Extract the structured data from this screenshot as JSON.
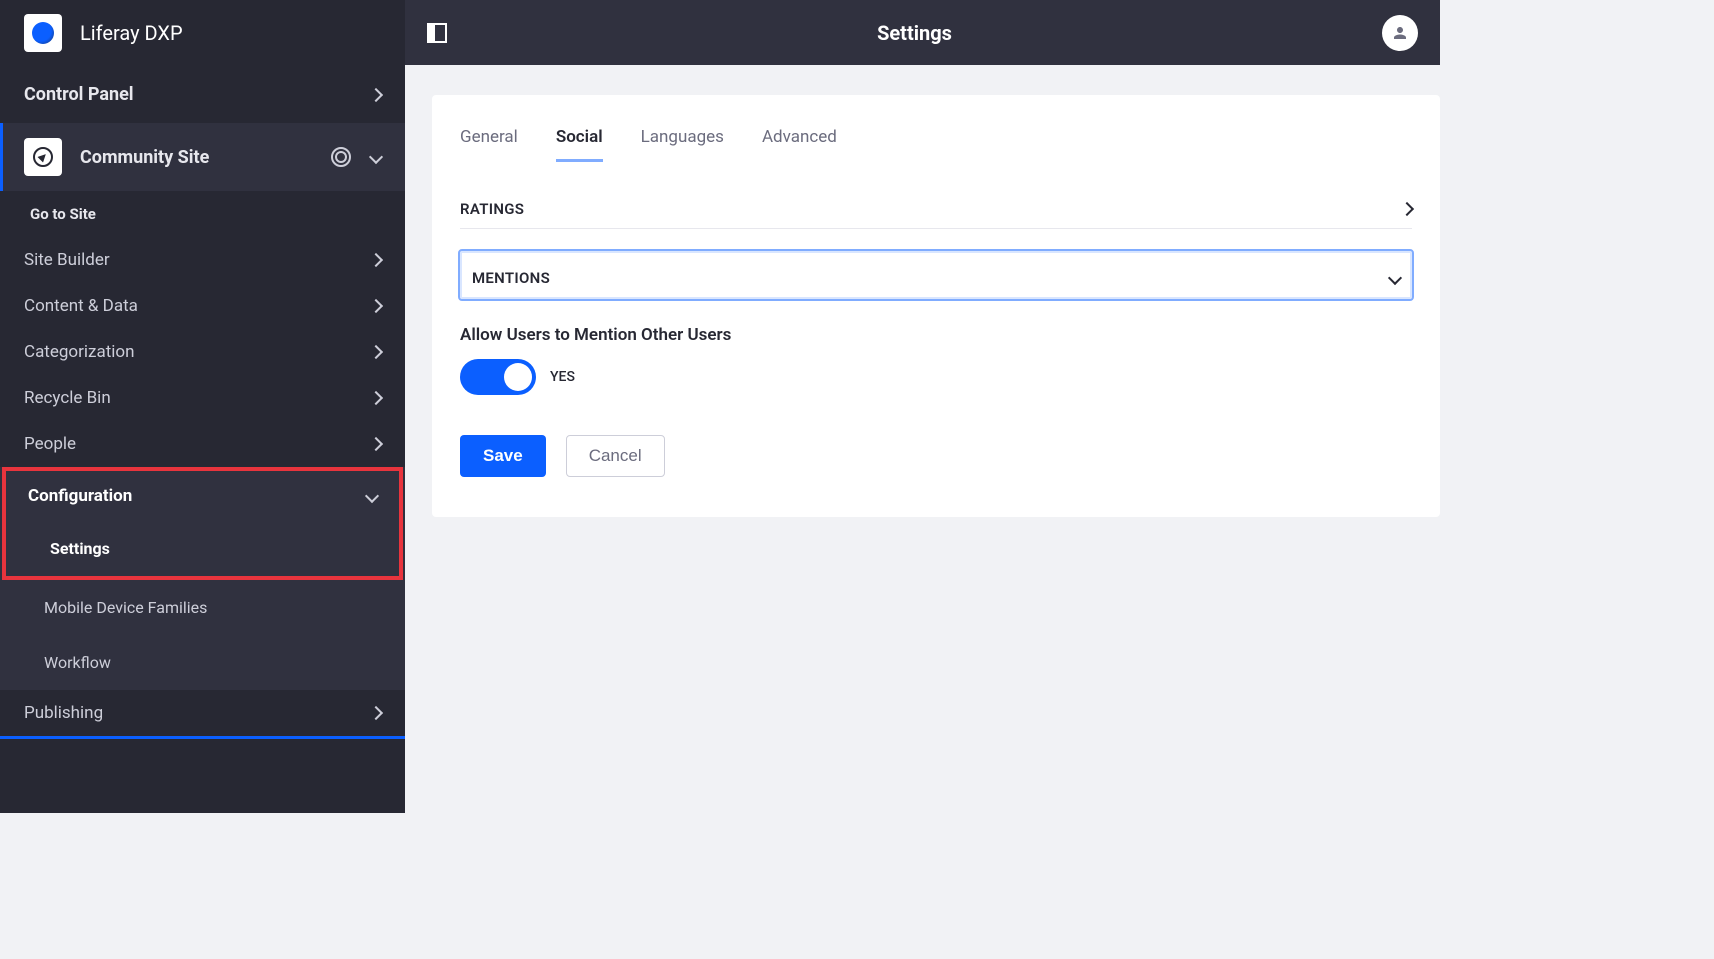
{
  "brand": {
    "title": "Liferay DXP"
  },
  "sidebar": {
    "control_panel": "Control Panel",
    "site_title": "Community Site",
    "go_to_site": "Go to Site",
    "items": [
      {
        "label": "Site Builder"
      },
      {
        "label": "Content & Data"
      },
      {
        "label": "Categorization"
      },
      {
        "label": "Recycle Bin"
      },
      {
        "label": "People"
      }
    ],
    "config": {
      "header": "Configuration",
      "children": [
        {
          "label": "Settings",
          "active": true
        },
        {
          "label": "Mobile Device Families",
          "active": false
        },
        {
          "label": "Workflow",
          "active": false
        }
      ]
    },
    "publishing": "Publishing"
  },
  "page": {
    "title": "Settings"
  },
  "tabs": [
    {
      "label": "General",
      "active": false
    },
    {
      "label": "Social",
      "active": true
    },
    {
      "label": "Languages",
      "active": false
    },
    {
      "label": "Advanced",
      "active": false
    }
  ],
  "sections": {
    "ratings": {
      "title": "RATINGS"
    },
    "mentions": {
      "title": "MENTIONS",
      "field_label": "Allow Users to Mention Other Users",
      "toggle_value": "YES"
    }
  },
  "buttons": {
    "save": "Save",
    "cancel": "Cancel"
  }
}
